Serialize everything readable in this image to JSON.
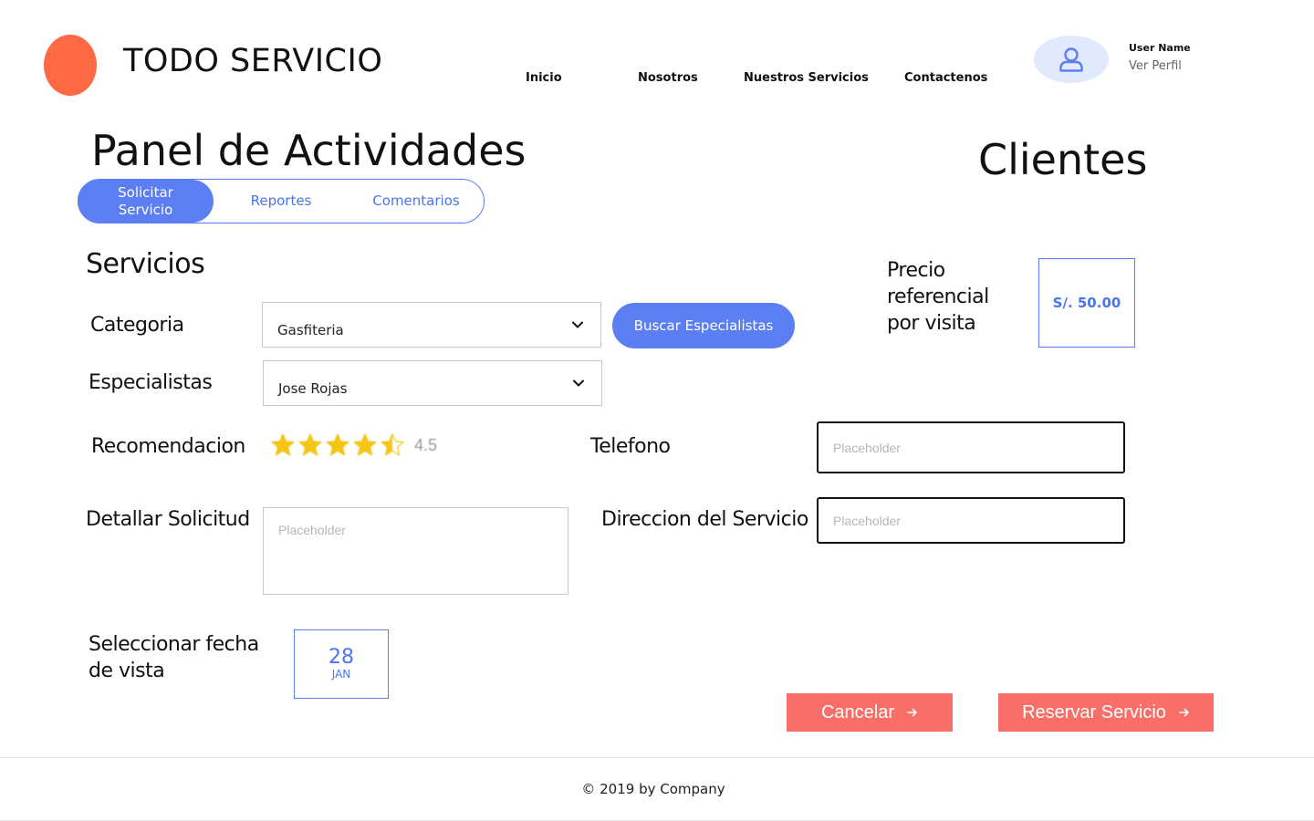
{
  "brand": {
    "name": "TODO SERVICIO",
    "logo_color": "#ff6a44"
  },
  "nav": {
    "items": [
      {
        "label": "Inicio"
      },
      {
        "label": "Nosotros"
      },
      {
        "label": "Nuestros Servicios"
      },
      {
        "label": "Contactenos"
      }
    ]
  },
  "user": {
    "name": "User Name",
    "profile_link": "Ver Perfil",
    "avatar_icon": "user-icon"
  },
  "page": {
    "title": "Panel de Actividades",
    "clients_title": "Clientes"
  },
  "tabs": [
    {
      "label": "Solicitar Servicio",
      "active": true
    },
    {
      "label": "Reportes",
      "active": false
    },
    {
      "label": "Comentarios",
      "active": false
    }
  ],
  "services": {
    "section_title": "Servicios",
    "category": {
      "label": "Categoria",
      "value": "Gasfiteria"
    },
    "specialist": {
      "label": "Especialistas",
      "value": "Jose Rojas"
    },
    "search_button": "Buscar Especialistas",
    "price": {
      "label": "Precio referencial por visita",
      "value": "S/. 50.00"
    },
    "recommendation": {
      "label": "Recomendacion",
      "rating": 4.5,
      "rating_text": "4.5",
      "max": 5
    },
    "phone": {
      "label": "Telefono",
      "placeholder": "Placeholder"
    },
    "details": {
      "label": "Detallar Solicitud",
      "placeholder": "Placeholder"
    },
    "address": {
      "label": "Direccion del Servicio",
      "placeholder": "Placeholder"
    },
    "date": {
      "label": "Seleccionar fecha de vista",
      "day": "28",
      "month": "JAN"
    }
  },
  "actions": {
    "cancel": "Cancelar",
    "reserve": "Reservar Servicio"
  },
  "footer": {
    "text": "© 2019 by Company"
  },
  "colors": {
    "accent": "#5c7ef3",
    "coral": "#f86e68",
    "star": "#f5c518"
  }
}
